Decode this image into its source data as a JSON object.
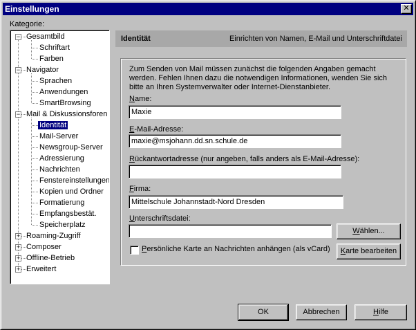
{
  "window": {
    "title": "Einstellungen",
    "close_glyph": "✕"
  },
  "sidebar": {
    "label": "Kategorie:",
    "items": [
      {
        "label": "Gesamtbild",
        "expander": "−"
      },
      {
        "label": "Schriftart"
      },
      {
        "label": "Farben"
      },
      {
        "label": "Navigator",
        "expander": "−"
      },
      {
        "label": "Sprachen"
      },
      {
        "label": "Anwendungen"
      },
      {
        "label": "SmartBrowsing"
      },
      {
        "label": "Mail & Diskussionsforen",
        "expander": "−"
      },
      {
        "label": "Identität",
        "selected": true
      },
      {
        "label": "Mail-Server"
      },
      {
        "label": "Newsgroup-Server"
      },
      {
        "label": "Adressierung"
      },
      {
        "label": "Nachrichten"
      },
      {
        "label": "Fenstereinstellungen"
      },
      {
        "label": "Kopien und Ordner"
      },
      {
        "label": "Formatierung"
      },
      {
        "label": "Empfangsbestät."
      },
      {
        "label": "Speicherplatz"
      },
      {
        "label": "Roaming-Zugriff",
        "expander": "+"
      },
      {
        "label": "Composer",
        "expander": "+"
      },
      {
        "label": "Offline-Betrieb",
        "expander": "+"
      },
      {
        "label": "Erweitert",
        "expander": "+"
      }
    ]
  },
  "main": {
    "header_title": "Identität",
    "header_subtitle": "Einrichten von Namen, E-Mail und Unterschriftdatei",
    "intro_text": "Zum Senden von Mail müssen zunächst die folgenden Angaben gemacht werden. Fehlen Ihnen dazu die notwendigen Informationen, wenden Sie sich bitte an Ihren Systemverwalter oder Internet-Dienstanbieter.",
    "name_label_u": "N",
    "name_label_rest": "ame:",
    "name_value": "Maxie",
    "email_label_u": "E",
    "email_label_rest": "-Mail-Adresse:",
    "email_value": "maxie@msjohann.dd.sn.schule.de",
    "reply_label_u": "R",
    "reply_label_rest": "ückantwortadresse (nur angeben, falls anders als E-Mail-Adresse):",
    "reply_value": "",
    "org_label_u": "F",
    "org_label_rest": "irma:",
    "org_value": "Mittelschule Johannstadt-Nord Dresden",
    "sig_label_u": "U",
    "sig_label_rest": "nterschriftsdatei:",
    "sig_value": "",
    "choose_button_u": "W",
    "choose_button_rest": "ählen...",
    "vcard_label_u": "P",
    "vcard_label_rest": "ersönliche Karte an Nachrichten anhängen (als vCard)",
    "edit_card_button_u": "K",
    "edit_card_button_rest": "arte bearbeiten"
  },
  "footer": {
    "ok": "OK",
    "cancel": "Abbrechen",
    "help_u": "H",
    "help_rest": "ilfe"
  }
}
